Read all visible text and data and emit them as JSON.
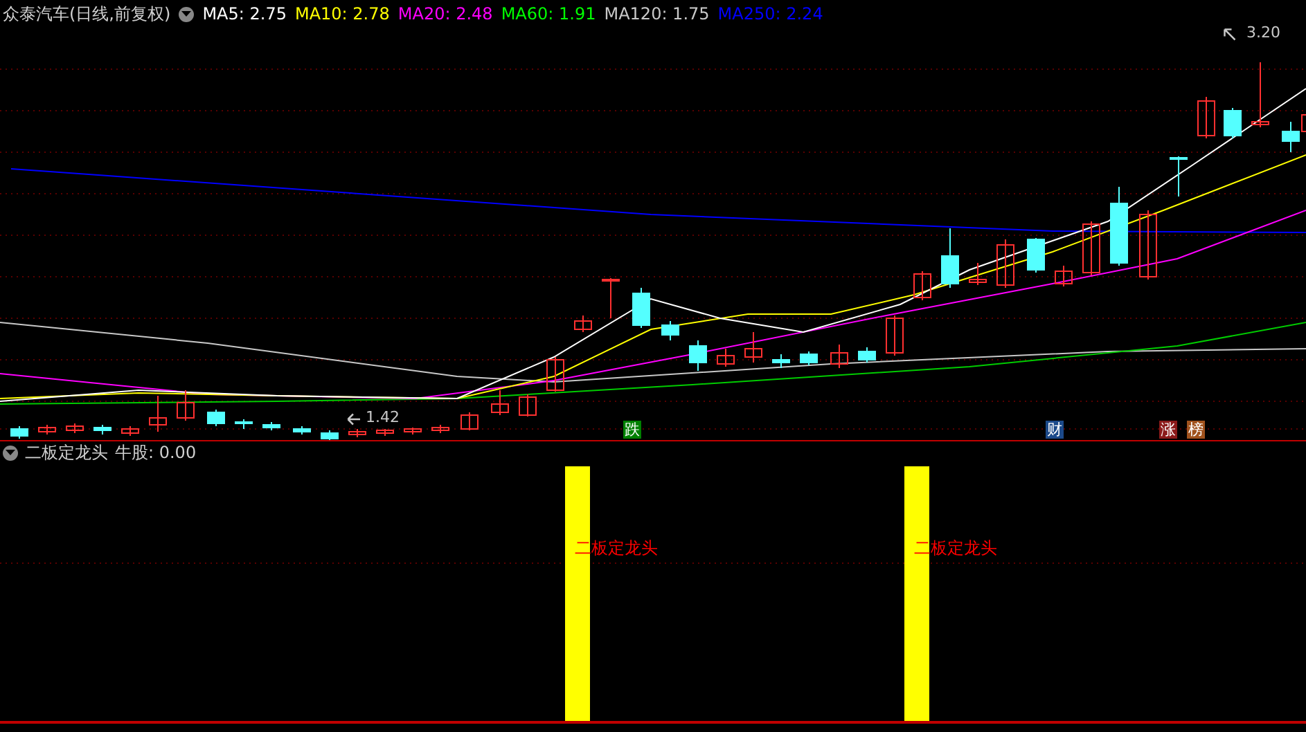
{
  "header": {
    "title": "众泰汽车(日线,前复权)",
    "ma": [
      {
        "label": "MA5: 2.75",
        "color": "#ffffff"
      },
      {
        "label": "MA10: 2.78",
        "color": "#ffff00"
      },
      {
        "label": "MA20: 2.48",
        "color": "#ff00ff"
      },
      {
        "label": "MA60: 1.91",
        "color": "#00ff00"
      },
      {
        "label": "MA120: 1.75",
        "color": "#c8c8c8"
      },
      {
        "label": "MA250: 2.24",
        "color": "#0000ff"
      }
    ]
  },
  "price_labels": [
    {
      "kind": "high",
      "text": "3.20"
    },
    {
      "kind": "low",
      "text": "1.42"
    }
  ],
  "event_markers": [
    {
      "text": "跌",
      "color": "#008000"
    },
    {
      "text": "财",
      "color": "#1c4a8a"
    },
    {
      "text": "涨",
      "color": "#8b1a1a"
    },
    {
      "text": "榜",
      "color": "#a0521d"
    }
  ],
  "indicator": {
    "title": "二板定龙头",
    "reading": "牛股: 0.00",
    "signals": [
      {
        "label": "二板定龙头"
      },
      {
        "label": "二板定龙头"
      }
    ]
  }
}
